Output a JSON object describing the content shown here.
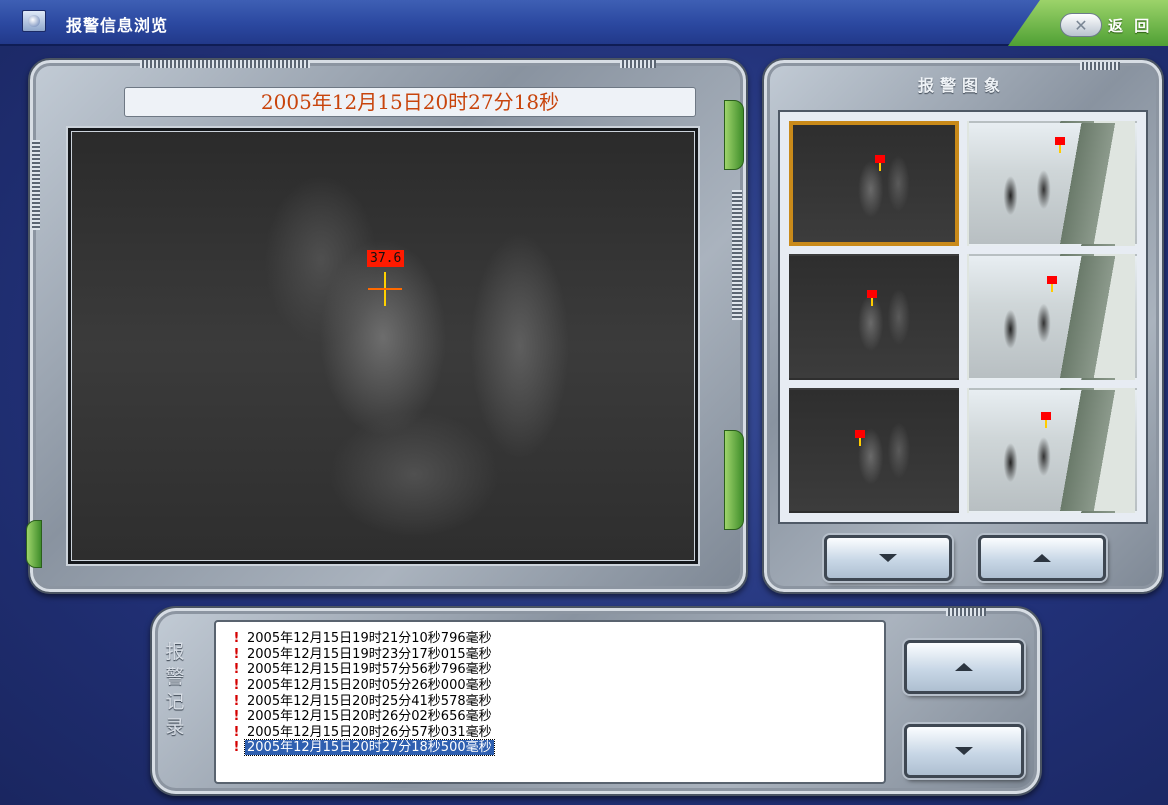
{
  "window": {
    "title": "报警信息浏览",
    "return_label": "返 回",
    "return_icon": "✕"
  },
  "viewer": {
    "timestamp": "2005年12月15日20时27分18秒",
    "temperature_label": "37.6"
  },
  "thumbnails": {
    "title": "报警图象",
    "items": [
      {
        "kind": "infrared",
        "selected": true
      },
      {
        "kind": "visible",
        "selected": false
      },
      {
        "kind": "infrared",
        "selected": false
      },
      {
        "kind": "visible",
        "selected": false
      },
      {
        "kind": "infrared",
        "selected": false
      },
      {
        "kind": "visible",
        "selected": false
      }
    ]
  },
  "alarm_log": {
    "label": "报警记录",
    "label_chars": [
      "报",
      "警",
      "记",
      "录"
    ],
    "marker": "!",
    "records": [
      "2005年12月15日19时21分10秒796毫秒",
      "2005年12月15日19时23分17秒015毫秒",
      "2005年12月15日19时57分56秒796毫秒",
      "2005年12月15日20时05分26秒000毫秒",
      "2005年12月15日20时25分41秒578毫秒",
      "2005年12月15日20时26分02秒656毫秒",
      "2005年12月15日20时26分57秒031毫秒",
      "2005年12月15日20时27分18秒500毫秒"
    ],
    "selected_index": 7
  },
  "colors": {
    "timestamp_text": "#c8440c",
    "selection": "#2e5fb0",
    "thumb_selected_border": "#c98a1a",
    "alarm_marker": "#d40000",
    "temp_label_bg": "#ff1a00"
  },
  "icons": {
    "up": "triangle-up-icon",
    "down": "triangle-down-icon",
    "close": "close-icon"
  }
}
